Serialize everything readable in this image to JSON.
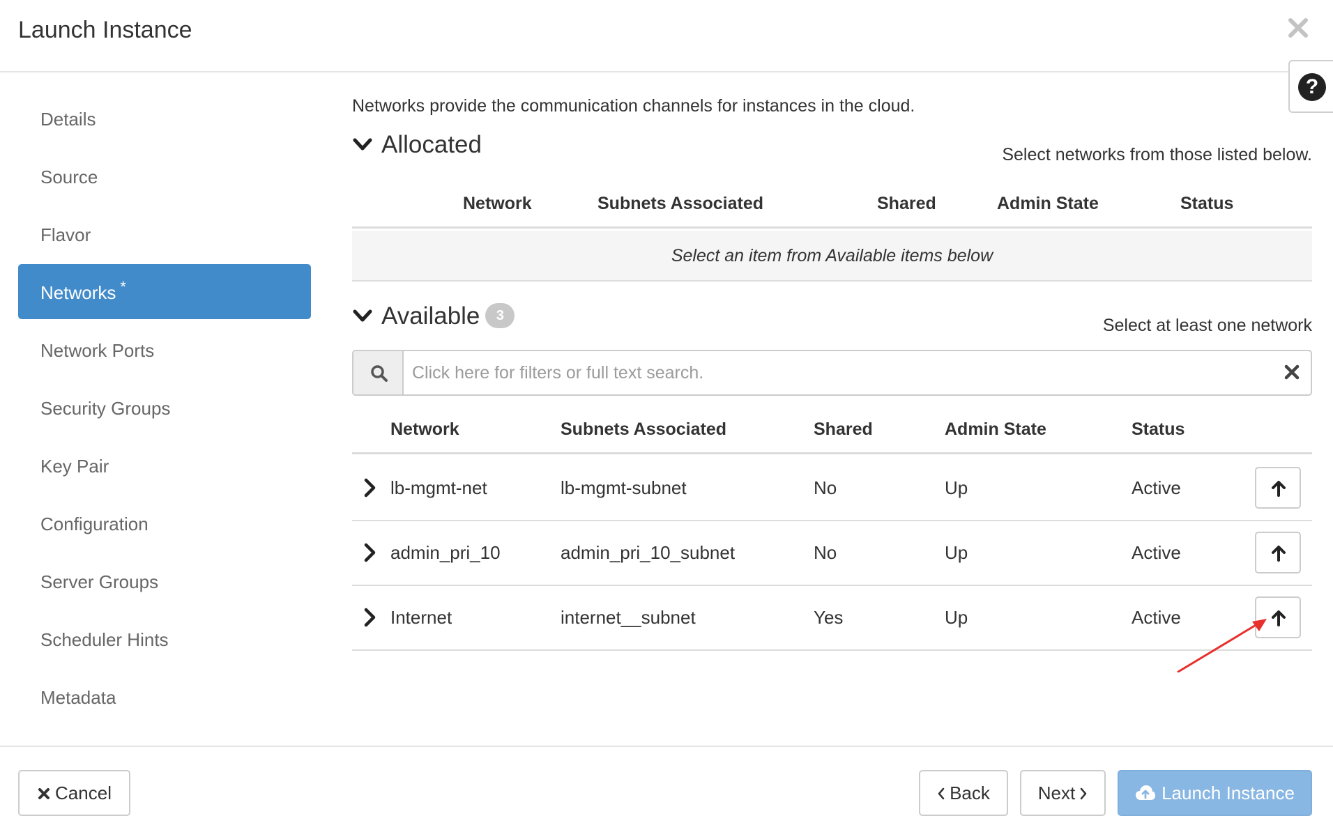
{
  "dialog": {
    "title": "Launch Instance",
    "close_icon": "close-icon",
    "help_icon": "question-circle-icon",
    "help_glyph": "?"
  },
  "sidebar": {
    "items": [
      {
        "label": "Details",
        "active": false
      },
      {
        "label": "Source",
        "active": false
      },
      {
        "label": "Flavor",
        "active": false
      },
      {
        "label": "Networks",
        "active": true,
        "required_mark": "*"
      },
      {
        "label": "Network Ports",
        "active": false
      },
      {
        "label": "Security Groups",
        "active": false
      },
      {
        "label": "Key Pair",
        "active": false
      },
      {
        "label": "Configuration",
        "active": false
      },
      {
        "label": "Server Groups",
        "active": false
      },
      {
        "label": "Scheduler Hints",
        "active": false
      },
      {
        "label": "Metadata",
        "active": false
      }
    ]
  },
  "main": {
    "intro": "Networks provide the communication channels for instances in the cloud.",
    "allocated": {
      "title": "Allocated",
      "hint": "Select networks from those listed below.",
      "columns": [
        "Network",
        "Subnets Associated",
        "Shared",
        "Admin State",
        "Status"
      ],
      "empty_message": "Select an item from Available items below"
    },
    "available": {
      "title": "Available",
      "count": "3",
      "hint": "Select at least one network",
      "search_placeholder": "Click here for filters or full text search.",
      "search_value": "",
      "columns": [
        "Network",
        "Subnets Associated",
        "Shared",
        "Admin State",
        "Status"
      ],
      "rows": [
        {
          "network": "lb-mgmt-net",
          "subnets": "lb-mgmt-subnet",
          "shared": "No",
          "admin_state": "Up",
          "status": "Active"
        },
        {
          "network": "admin_pri_10",
          "subnets": "admin_pri_10_subnet",
          "shared": "No",
          "admin_state": "Up",
          "status": "Active"
        },
        {
          "network": "Internet",
          "subnets": "internet__subnet",
          "shared": "Yes",
          "admin_state": "Up",
          "status": "Active"
        }
      ]
    }
  },
  "footer": {
    "cancel_label": "Cancel",
    "back_label": "Back",
    "next_label": "Next",
    "launch_label": "Launch Instance"
  },
  "colors": {
    "active_nav": "#428bca",
    "primary_button": "#89b7e3",
    "annotation_arrow": "#e8302c"
  }
}
